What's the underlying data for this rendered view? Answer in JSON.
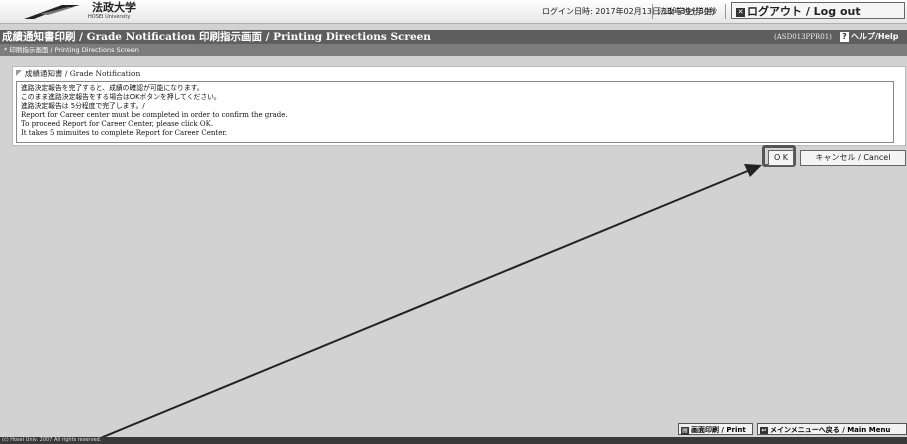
{
  "header": {
    "university_name": "法政大学",
    "university_name_en": "HOSEI University",
    "login_time": "ログイン日時: 2017年02月13日 11時30分50秒",
    "user_info": "法政 学生(学生)",
    "logout_label": "ログアウト / Log out",
    "logout_icon": "close-box-icon"
  },
  "titlebar": {
    "title": "成績通知書印刷 / Grade Notification  印刷指示画面 / Printing Directions Screen",
    "screen_id": "(ASD013PPR01)",
    "help_label": "ヘルプ/Help",
    "help_icon": "question-icon"
  },
  "breadcrumb": "* 印刷指示画面 / Printing Directions Screen",
  "panel": {
    "header": "成績通知書 / Grade Notification",
    "messages": [
      "進路決定報告を完了すると、成績の確認が可能になります。",
      "このまま進路決定報告をする場合はOKボタンを押してください。",
      "進路決定報告は 5分程度で完了します。/",
      "Report for Career center must be completed in order to confirm the grade.",
      "To proceed Report for Career Center, please click OK.",
      "It takes 5 mimuites to complete Report for Career Center."
    ]
  },
  "actions": {
    "ok_label": "O K",
    "cancel_label": "キャンセル / Cancel"
  },
  "bottom": {
    "print_label": "画面印刷 / Print",
    "print_icon": "printer-icon",
    "mainmenu_label": "メインメニューへ戻る / Main Menu",
    "mainmenu_icon": "return-icon"
  },
  "footer": {
    "copyright": "(c) Hosei Univ. 2007 All rights reserved."
  },
  "colors": {
    "titlebar": "#5e5e5e",
    "breadcrumbbar": "#7c7c7c",
    "background": "#d2d2d2",
    "annotation": "#333333"
  }
}
